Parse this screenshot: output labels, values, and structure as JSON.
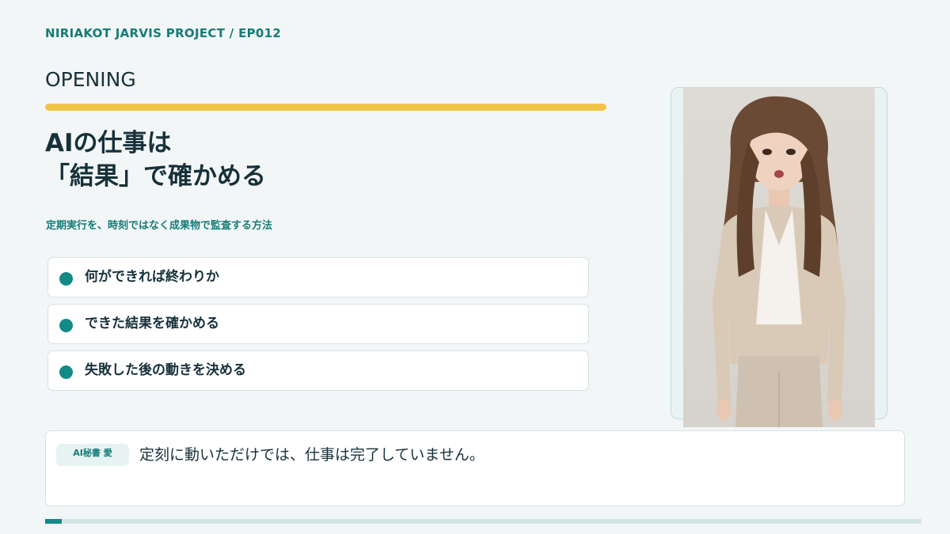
{
  "header": {
    "project": "NIRIAKOT JARVIS PROJECT / EP012",
    "section": "OPENING"
  },
  "main": {
    "headline_lines": [
      "AIの仕事は",
      "「結果」で確かめる"
    ],
    "subtitle": "定期実行を、時刻ではなく成果物で監査する方法",
    "points": [
      {
        "label": "何ができれば終わりか"
      },
      {
        "label": "できた結果を確かめる"
      },
      {
        "label": "失敗した後の動きを決める"
      }
    ]
  },
  "dialog": {
    "speaker": "AI秘書 愛",
    "text": "定刻に動いただけでは、仕事は完了していません。"
  },
  "progress": {
    "value": 0.019
  },
  "colors": {
    "accent": "#f1c54a",
    "teal": "#128a88",
    "text": "#17313a",
    "background": "#f3f6f6"
  }
}
